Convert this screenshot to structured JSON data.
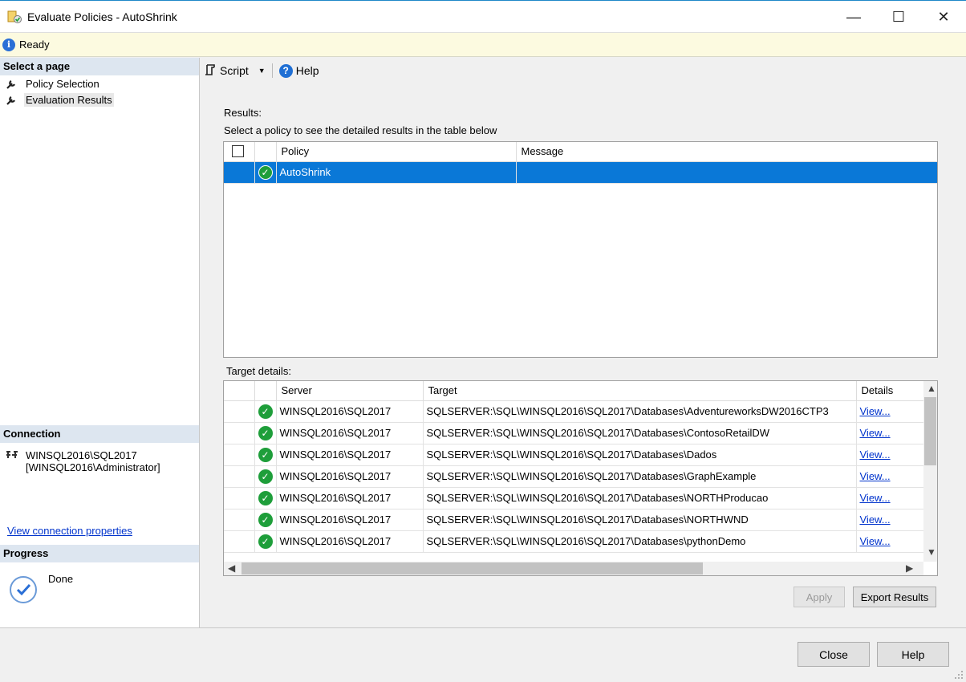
{
  "window": {
    "title": "Evaluate Policies - AutoShrink",
    "minimize": "—",
    "maximize": "☐",
    "close": "✕"
  },
  "status": {
    "icon": "info-icon",
    "text": "Ready"
  },
  "sidebar": {
    "header": "Select a page",
    "items": [
      {
        "label": "Policy Selection",
        "icon": "wrench-icon"
      },
      {
        "label": "Evaluation Results",
        "icon": "wrench-icon",
        "selected": true
      }
    ],
    "connection": {
      "header": "Connection",
      "server": "WINSQL2016\\SQL2017",
      "user": "[WINSQL2016\\Administrator]",
      "link": "View connection properties"
    },
    "progress": {
      "header": "Progress",
      "text": "Done"
    }
  },
  "toolbar": {
    "script_label": "Script",
    "help_label": "Help"
  },
  "results": {
    "label": "Results:",
    "instruction": "Select a policy to see the detailed results in the table below",
    "columns": [
      "Policy",
      "Message"
    ],
    "rows": [
      {
        "policy": "AutoShrink",
        "message": ""
      }
    ]
  },
  "target": {
    "label": "Target details:",
    "columns": [
      "Server",
      "Target",
      "Details"
    ],
    "rows": [
      {
        "server": "WINSQL2016\\SQL2017",
        "target": "SQLSERVER:\\SQL\\WINSQL2016\\SQL2017\\Databases\\AdventureworksDW2016CTP3",
        "details": "View..."
      },
      {
        "server": "WINSQL2016\\SQL2017",
        "target": "SQLSERVER:\\SQL\\WINSQL2016\\SQL2017\\Databases\\ContosoRetailDW",
        "details": "View..."
      },
      {
        "server": "WINSQL2016\\SQL2017",
        "target": "SQLSERVER:\\SQL\\WINSQL2016\\SQL2017\\Databases\\Dados",
        "details": "View..."
      },
      {
        "server": "WINSQL2016\\SQL2017",
        "target": "SQLSERVER:\\SQL\\WINSQL2016\\SQL2017\\Databases\\GraphExample",
        "details": "View..."
      },
      {
        "server": "WINSQL2016\\SQL2017",
        "target": "SQLSERVER:\\SQL\\WINSQL2016\\SQL2017\\Databases\\NORTHProducao",
        "details": "View..."
      },
      {
        "server": "WINSQL2016\\SQL2017",
        "target": "SQLSERVER:\\SQL\\WINSQL2016\\SQL2017\\Databases\\NORTHWND",
        "details": "View..."
      },
      {
        "server": "WINSQL2016\\SQL2017",
        "target": "SQLSERVER:\\SQL\\WINSQL2016\\SQL2017\\Databases\\pythonDemo",
        "details": "View..."
      }
    ]
  },
  "buttons": {
    "apply": "Apply",
    "export": "Export Results",
    "close": "Close",
    "help": "Help"
  },
  "colors": {
    "selection": "#0a78d7",
    "success": "#1e9e3a",
    "link": "#0033cc",
    "status_bg": "#fcfae0"
  }
}
